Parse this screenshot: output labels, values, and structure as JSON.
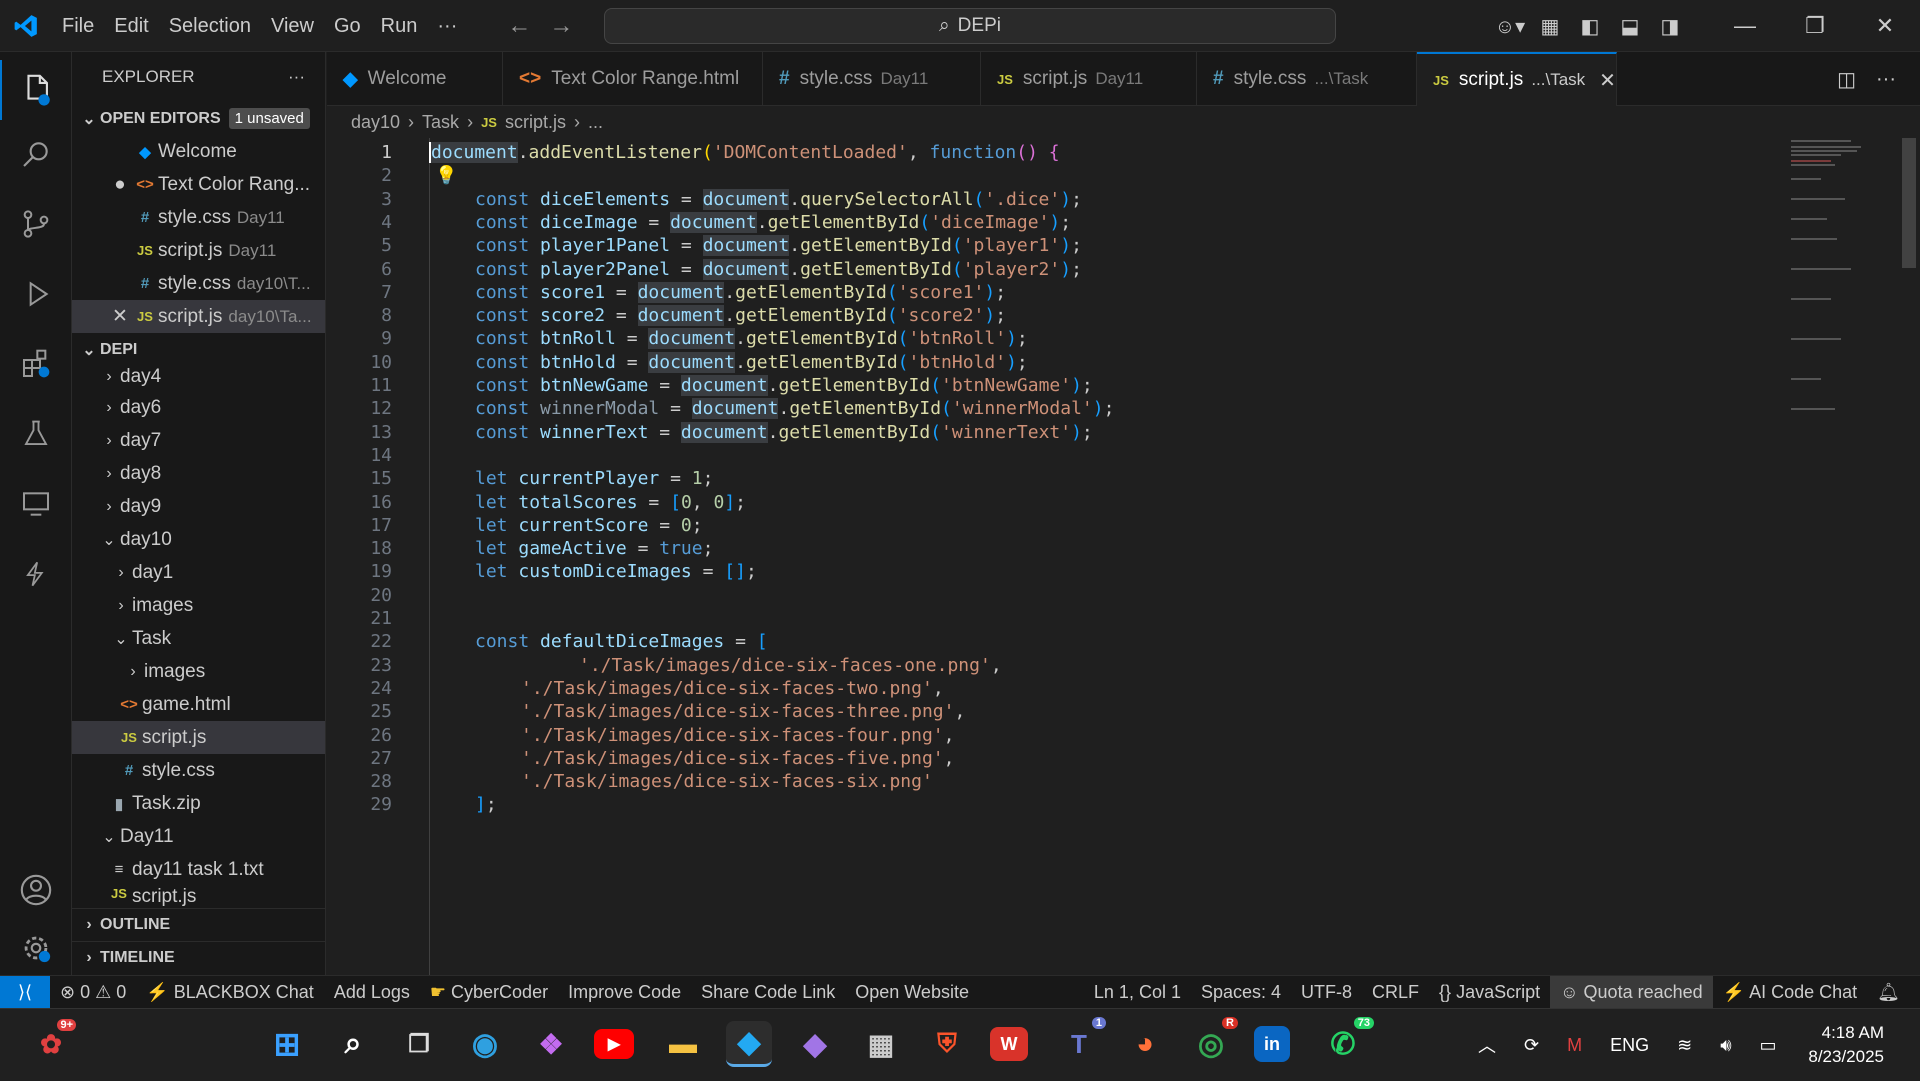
{
  "menu": [
    "File",
    "Edit",
    "Selection",
    "View",
    "Go",
    "Run",
    "···"
  ],
  "command_center": "DEPi",
  "explorer": {
    "title": "EXPLORER",
    "open_editors_label": "OPEN EDITORS",
    "unsaved_badge": "1 unsaved",
    "open_editors": [
      {
        "name": "Welcome",
        "sub": ""
      },
      {
        "name": "Text Color Rang...",
        "sub": ""
      },
      {
        "name": "style.css",
        "sub": "Day11"
      },
      {
        "name": "script.js",
        "sub": "Day11"
      },
      {
        "name": "style.css",
        "sub": "day10\\T..."
      },
      {
        "name": "script.js",
        "sub": "day10\\Ta..."
      }
    ],
    "workspace_label": "DEPI",
    "tree": [
      "day4",
      "day6",
      "day7",
      "day8",
      "day9",
      "day10",
      "day1",
      "images",
      "Task",
      "images",
      "game.html",
      "script.js",
      "style.css",
      "Task.zip",
      "Day11",
      "day11 task 1.txt",
      "script.js"
    ],
    "outline_label": "OUTLINE",
    "timeline_label": "TIMELINE"
  },
  "tabs": [
    {
      "name": "Welcome",
      "sub": ""
    },
    {
      "name": "Text Color Range.html",
      "sub": ""
    },
    {
      "name": "style.css",
      "sub": "Day11"
    },
    {
      "name": "script.js",
      "sub": "Day11"
    },
    {
      "name": "style.css",
      "sub": "...\\Task"
    },
    {
      "name": "script.js",
      "sub": "...\\Task"
    }
  ],
  "breadcrumb": [
    "day10",
    "Task",
    "script.js",
    "..."
  ],
  "line_numbers": [
    "1",
    "2",
    "3",
    "4",
    "5",
    "6",
    "7",
    "8",
    "9",
    "10",
    "11",
    "12",
    "13",
    "14",
    "15",
    "16",
    "17",
    "18",
    "19",
    "20",
    "21",
    "22",
    "23",
    "24",
    "25",
    "26",
    "27",
    "28",
    "29"
  ],
  "status": {
    "problems": "0",
    "warnings": "0",
    "items": [
      "BLACKBOX Chat",
      "Add Logs",
      "CyberCoder",
      "Improve Code",
      "Share Code Link",
      "Open Website"
    ],
    "position": "Ln 1, Col 1",
    "spaces": "Spaces: 4",
    "encoding": "UTF-8",
    "eol": "CRLF",
    "language": "JavaScript",
    "quota": "Quota reached",
    "ai_chat": "AI Code Chat"
  },
  "taskbar": {
    "lang": "ENG",
    "time": "4:18 AM",
    "date": "8/23/2025",
    "badge_left": "9+",
    "badge_teams": "1",
    "badge_whatsapp": "73",
    "badge_brave": "R"
  },
  "colors": {
    "accent": "#0078d4",
    "bg": "#1f1f1f",
    "sidebar": "#181818"
  }
}
